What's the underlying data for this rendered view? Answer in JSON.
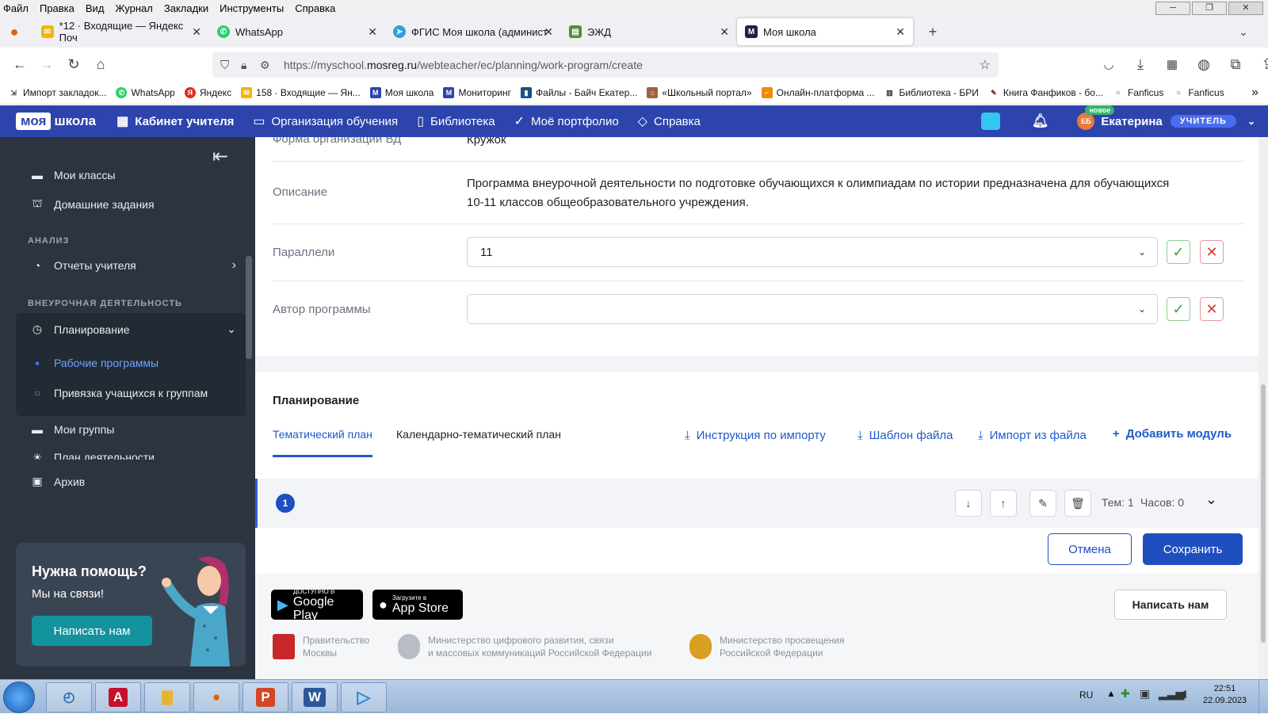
{
  "menubar": {
    "items": [
      "Файл",
      "Правка",
      "Вид",
      "Журнал",
      "Закладки",
      "Инструменты",
      "Справка"
    ]
  },
  "tabs": [
    {
      "label": "*12 · Входящие — Яндекс Поч",
      "icon": "mail-icon",
      "color": "#f8b400"
    },
    {
      "label": "WhatsApp",
      "icon": "whatsapp-icon",
      "color": "#25d366"
    },
    {
      "label": "ФГИС Моя школа (админист",
      "icon": "telegram-icon",
      "color": "#2aa3e0"
    },
    {
      "label": "ЭЖД",
      "icon": "document-icon",
      "color": "#5a8a3a"
    },
    {
      "label": "Моя школа",
      "icon": "m-logo-icon",
      "color": "#1b2350"
    }
  ],
  "url": {
    "prefix": "https://myschool.",
    "domain": "mosreg.ru",
    "path": "/webteacher/ec/planning/work-program/create"
  },
  "bookmarks": [
    "Импорт закладок...",
    "WhatsApp",
    "Яндекс",
    "158 · Входящие — Ян...",
    "Моя школа",
    "Мониторинг",
    "Файлы - Байч Екатер...",
    "«Школьный портал»",
    "Онлайн-платформа ...",
    "Библиотека - БРИ",
    "Книга Фанфиков - бо...",
    "Fanficus",
    "Fanficus"
  ],
  "header": {
    "logo1": "моя",
    "logo2": "школа",
    "nav": [
      "Кабинет учителя",
      "Организация обучения",
      "Библиотека",
      "Моё портфолио",
      "Справка"
    ],
    "badge": "новое",
    "initials": "ЕБ",
    "user": "Екатерина",
    "role": "УЧИТЕЛЬ"
  },
  "sidebar": {
    "items": [
      "Мои классы",
      "Домашние задания"
    ],
    "section_analysis": "АНАЛИЗ",
    "reports": "Отчеты учителя",
    "section_extra": "ВНЕУРОЧНАЯ ДЕЯТЕЛЬНОСТЬ",
    "planning": "Планирование",
    "sub1": "Рабочие программы",
    "sub2": "Привязка учащихся к группам",
    "groups": "Мои группы",
    "plan_cut": "План деятельности",
    "archive": "Архив",
    "help_title": "Нужна помощь?",
    "help_sub": "Мы на связи!",
    "help_btn": "Написать нам"
  },
  "form": {
    "org_label": "Форма организации ВД",
    "org_value": "Кружок",
    "desc_label": "Описание",
    "desc_line1": "Программа внеурочной деятельности по подготовке обучающихся к олимпиадам по истории предназначена для обучающихся",
    "desc_line2": "10-11 классов общеобразовательного учреждения.",
    "par_label": "Параллели",
    "par_value": "11",
    "author_label": "Автор программы",
    "author_value": ""
  },
  "planning": {
    "title": "Планирование",
    "tab1": "Тематический план",
    "tab2": "Календарно-тематический план",
    "link1": "Инструкция по импорту",
    "link2": "Шаблон файла",
    "link3": "Импорт из файла",
    "link4": "Добавить модуль"
  },
  "module": {
    "num": "1",
    "topics": "Тем: 1",
    "hours": "Часов: 0"
  },
  "actions": {
    "cancel": "Отмена",
    "save": "Сохранить"
  },
  "footer": {
    "gp_small": "ДОСТУПНО В",
    "gp_big": "Google Play",
    "as_small": "Загрузите в",
    "as_big": "App Store",
    "write": "Написать нам",
    "gov1a": "Правительство",
    "gov1b": "Москвы",
    "gov2a": "Министерство цифрового развития, связи",
    "gov2b": "и массовых коммуникаций Российской Федерации",
    "gov3a": "Министерство просвещения",
    "gov3b": "Российской Федерации"
  },
  "taskbar": {
    "lang": "RU",
    "time": "22:51",
    "date": "22.09.2023"
  },
  "colors": {
    "brand": "#2d44ad",
    "sidebar": "#2b3440",
    "link": "#1f5ac8",
    "save": "#1f4fbf",
    "help_btn": "#13939e"
  }
}
